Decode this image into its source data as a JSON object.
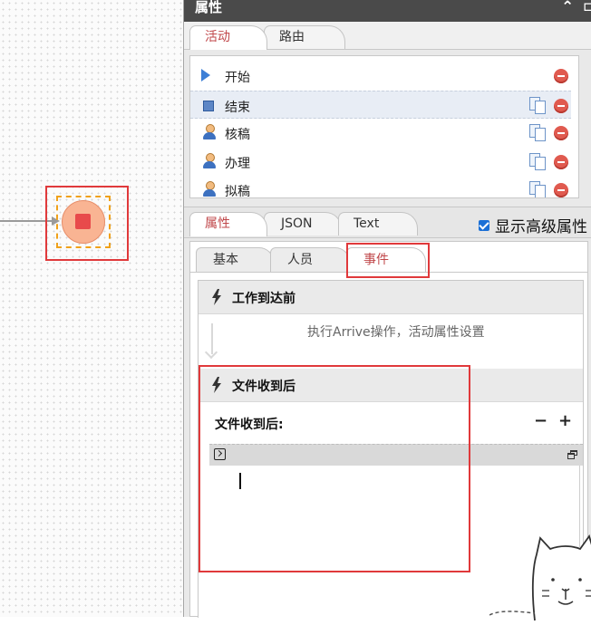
{
  "panel": {
    "title": "属性"
  },
  "top_tabs": [
    {
      "label": "活动"
    },
    {
      "label": "路由"
    }
  ],
  "activities": [
    {
      "label": "开始",
      "icon": "play-icon"
    },
    {
      "label": "结束",
      "icon": "stop-icon"
    },
    {
      "label": "核稿",
      "icon": "user-icon"
    },
    {
      "label": "办理",
      "icon": "user-icon"
    },
    {
      "label": "拟稿",
      "icon": "user-icon"
    }
  ],
  "mid_tabs": [
    {
      "label": "属性"
    },
    {
      "label": "JSON"
    },
    {
      "label": "Text"
    }
  ],
  "advanced": {
    "label": "显示高级属性",
    "checked": true
  },
  "inner_tabs": [
    {
      "label": "基本"
    },
    {
      "label": "人员"
    },
    {
      "label": "事件"
    }
  ],
  "events": {
    "arrive": {
      "title": "工作到达前",
      "desc": "执行Arrive操作，活动属性设置"
    },
    "receive": {
      "title": "文件收到后",
      "field_label": "文件收到后:",
      "minus": "−",
      "plus": "+"
    }
  },
  "colors": {
    "accent_red": "#c0474a",
    "highlight_box": "#e0393b",
    "title_bar": "#4a4a4a"
  }
}
